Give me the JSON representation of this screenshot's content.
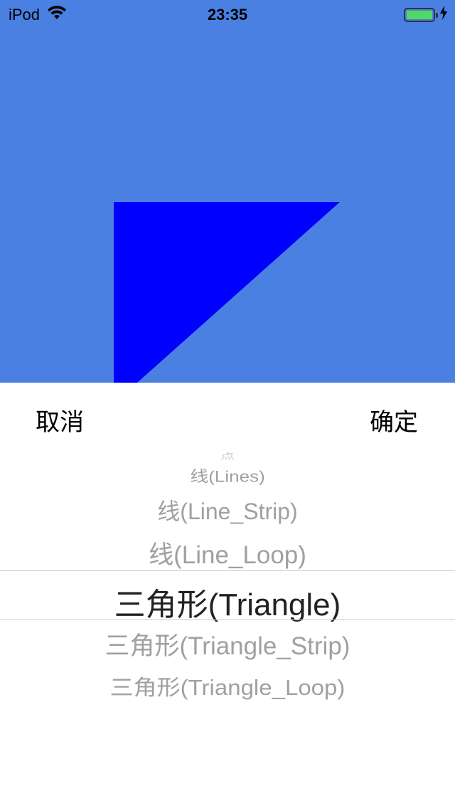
{
  "status_bar": {
    "carrier": "iPod",
    "time": "23:35",
    "battery_level": 1.0,
    "icons": [
      "wifi-icon",
      "battery-icon",
      "charging-bolt-icon"
    ]
  },
  "gl_view": {
    "background_color": "#4a80e2",
    "shape_color": "#0000ff",
    "shape": "triangle"
  },
  "toolbar": {
    "cancel_label": "取消",
    "confirm_label": "确定"
  },
  "picker": {
    "items": [
      "点",
      "线(Lines)",
      "线(Line_Strip)",
      "线(Line_Loop)",
      "三角形(Triangle)",
      "三角形(Triangle_Strip)",
      "三角形(Triangle_Loop)"
    ],
    "selected": "三角形(Triangle)"
  }
}
